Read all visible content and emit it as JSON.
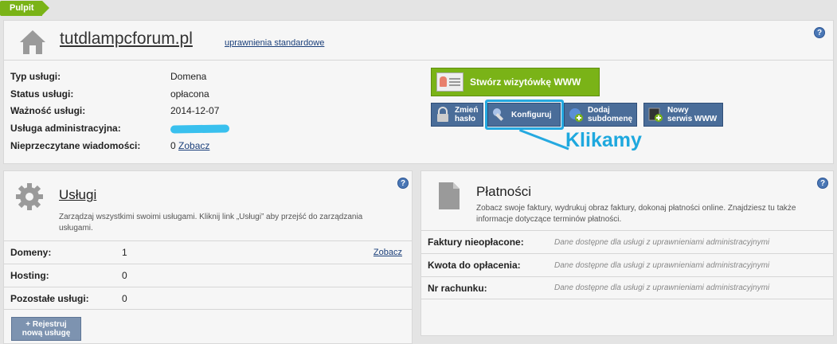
{
  "breadcrumb": {
    "label": "Pulpit"
  },
  "service": {
    "domain": "tutdlampcforum.pl",
    "permission_link": "uprawnienia standardowe",
    "rows": [
      {
        "label": "Typ usługi:",
        "value": "Domena"
      },
      {
        "label": "Status usługi:",
        "value": "opłacona"
      },
      {
        "label": "Ważność usługi:",
        "value": "2014-12-07"
      },
      {
        "label": "Usługa administracyjna:",
        "value": ""
      },
      {
        "label": "Nieprzeczytane wiadomości:",
        "value": "0",
        "link": "Zobacz"
      }
    ]
  },
  "actions": {
    "create_www": "Stwórz wizytówkę WWW",
    "change_password": [
      "Zmień",
      "hasło"
    ],
    "configure": "Konfiguruj",
    "add_subdomain": [
      "Dodaj",
      "subdomenę"
    ],
    "new_www": [
      "Nowy",
      "serwis WWW"
    ]
  },
  "annotation": {
    "text": "Klikamy"
  },
  "uslugi": {
    "title": "Usługi",
    "description": "Zarządzaj wszystkimi swoimi usługami. Kliknij link „Usługi” aby przejść do zarządzania usługami.",
    "rows": [
      {
        "label": "Domeny:",
        "value": "1",
        "link": "Zobacz"
      },
      {
        "label": "Hosting:",
        "value": "0"
      },
      {
        "label": "Pozostałe usługi:",
        "value": "0"
      }
    ],
    "register_button": [
      "Rejestruj",
      "nową usługę"
    ]
  },
  "platnosci": {
    "title": "Płatności",
    "description": "Zobacz swoje faktury, wydrukuj obraz faktury, dokonaj płatności online. Znajdziesz tu także informacje dotyczące terminów płatności.",
    "rows": [
      {
        "label": "Faktury nieopłacone:",
        "value": "Dane dostępne dla usługi z uprawnieniami administracyjnymi"
      },
      {
        "label": "Kwota do opłacenia:",
        "value": "Dane dostępne dla usługi z uprawnieniami administracyjnymi"
      },
      {
        "label": "Nr rachunku:",
        "value": "Dane dostępne dla usługi z uprawnieniami administracyjnymi"
      }
    ]
  },
  "help_label": "?",
  "colors": {
    "accent_green": "#7ab317",
    "button_blue": "#4a6d99",
    "annotation_blue": "#25a9e0"
  }
}
